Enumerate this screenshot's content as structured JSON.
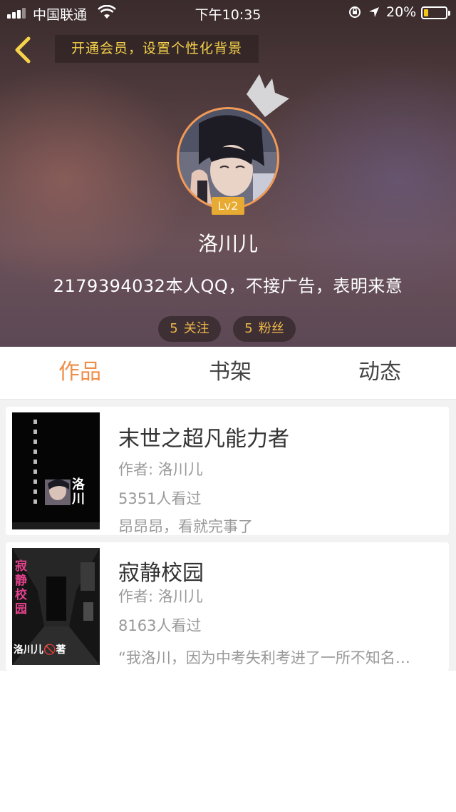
{
  "status_bar": {
    "carrier": "中国联通",
    "time": "下午10:35",
    "battery_percent": "20%",
    "battery_level": 0.2
  },
  "header": {
    "promo_text": "开通会员，设置个性化背景",
    "level": "Lv2",
    "username": "洛川儿",
    "bio": "2179394032本人QQ，不接广告，表明来意",
    "following_count": "5",
    "following_label": "关注",
    "fans_count": "5",
    "fans_label": "粉丝"
  },
  "tabs": [
    {
      "label": "作品",
      "active": true
    },
    {
      "label": "书架",
      "active": false
    },
    {
      "label": "动态",
      "active": false
    }
  ],
  "books": [
    {
      "title": "末世之超凡能力者",
      "author": "作者: 洛川儿",
      "views": "5351人看过",
      "description": "昂昂昂，看就完事了",
      "cover_text": "洛川"
    },
    {
      "title": "寂静校园",
      "author": "作者: 洛川儿",
      "views": "8163人看过",
      "description": "“我洛川，因为中考失利考进了一所不知名…",
      "cover_text": "寂静校园",
      "cover_signature": "洛川儿🚫著"
    }
  ],
  "colors": {
    "accent": "#ef8d46",
    "promo_text": "#f6d34a",
    "stat_text": "#f0b84a",
    "level_badge": "#e7aa33"
  }
}
